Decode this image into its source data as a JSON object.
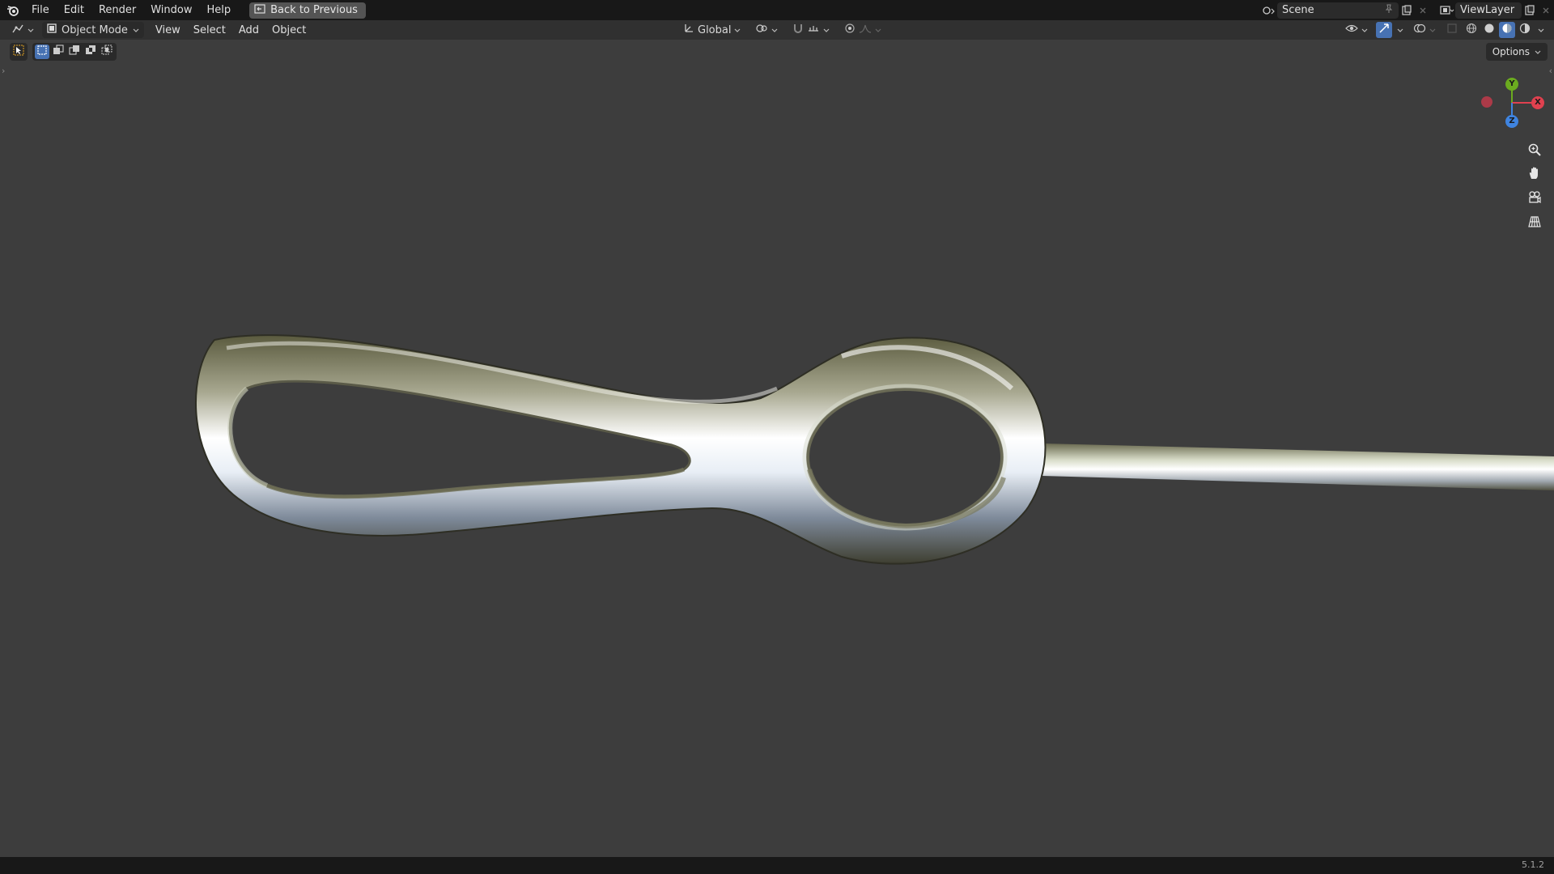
{
  "topbar": {
    "menus": [
      "File",
      "Edit",
      "Render",
      "Window",
      "Help"
    ],
    "back_label": "Back to Previous",
    "scene_name": "Scene",
    "view_layer": "ViewLayer"
  },
  "header": {
    "mode": "Object Mode",
    "menus": [
      "View",
      "Select",
      "Add",
      "Object"
    ],
    "orientation": "Global"
  },
  "options_label": "Options",
  "gizmo": {
    "x": "X",
    "y": "Y",
    "z": "Z"
  },
  "status": {
    "version": "5.1.2"
  },
  "colors": {
    "accent": "#4772b3",
    "axis_x": "#e0414f",
    "axis_y": "#6bab1f",
    "axis_z": "#3f84e0",
    "viewport_bg": "#3d3d3d"
  }
}
